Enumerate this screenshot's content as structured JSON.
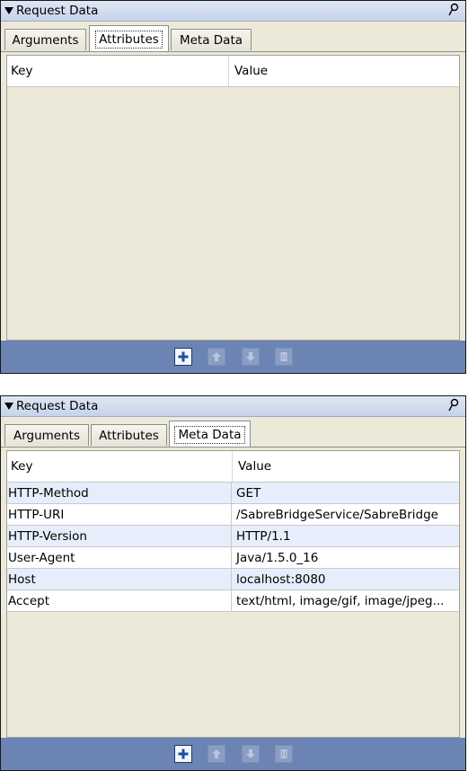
{
  "panels": [
    {
      "title": "Request Data",
      "tabs": [
        "Arguments",
        "Attributes",
        "Meta Data"
      ],
      "selected_tab": "Attributes",
      "columns": [
        "Key",
        "Value"
      ],
      "rows": []
    },
    {
      "title": "Request Data",
      "tabs": [
        "Arguments",
        "Attributes",
        "Meta Data"
      ],
      "selected_tab": "Meta Data",
      "columns": [
        "Key",
        "Value"
      ],
      "rows": [
        {
          "key": "HTTP-Method",
          "value": "GET"
        },
        {
          "key": "HTTP-URI",
          "value": "/SabreBridgeService/SabreBridge"
        },
        {
          "key": "HTTP-Version",
          "value": "HTTP/1.1"
        },
        {
          "key": "User-Agent",
          "value": "Java/1.5.0_16"
        },
        {
          "key": "Host",
          "value": "localhost:8080"
        },
        {
          "key": "Accept",
          "value": "text/html, image/gif, image/jpeg..."
        }
      ]
    }
  ],
  "toolbar_buttons": [
    {
      "icon": "add-icon",
      "enabled": true
    },
    {
      "icon": "move-up-icon",
      "enabled": false
    },
    {
      "icon": "move-down-icon",
      "enabled": false
    },
    {
      "icon": "delete-icon",
      "enabled": false
    }
  ],
  "colors": {
    "toolbar": "#6b84b4",
    "title_bar": "#c7d3ea",
    "row_alt": "#e6eefb",
    "panel_bg": "#ece9d8"
  }
}
